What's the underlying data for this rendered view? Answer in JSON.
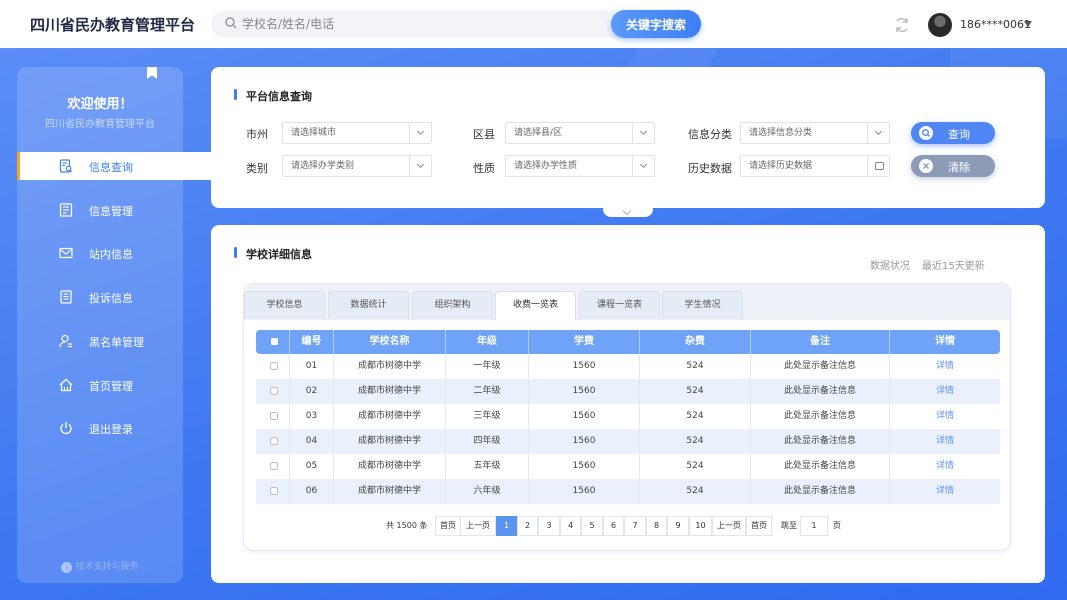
{
  "app": {
    "title": "四川省民办教育管理平台"
  },
  "header": {
    "search_placeholder": "学校名/姓名/电话",
    "search_button": "关键字搜索",
    "user_phone": "186****0061"
  },
  "sidebar": {
    "welcome": "欢迎使用！",
    "subtitle": "四川省民办教育管理平台",
    "items": [
      {
        "label": "信息查询",
        "icon": "search-doc-icon",
        "active": true
      },
      {
        "label": "信息管理",
        "icon": "manage-doc-icon",
        "active": false
      },
      {
        "label": "站内信息",
        "icon": "mail-icon",
        "active": false
      },
      {
        "label": "投诉信息",
        "icon": "complaint-doc-icon",
        "active": false
      },
      {
        "label": "黑名单管理",
        "icon": "user-blacklist-icon",
        "active": false
      },
      {
        "label": "首页管理",
        "icon": "home-icon",
        "active": false
      },
      {
        "label": "退出登录",
        "icon": "power-icon",
        "active": false
      }
    ],
    "footer": "技术支持与服务"
  },
  "query_panel": {
    "title": "平台信息查询",
    "fields": {
      "city": {
        "label": "市州",
        "placeholder": "请选择城市"
      },
      "district": {
        "label": "区县",
        "placeholder": "请选择县/区"
      },
      "info_type": {
        "label": "信息分类",
        "placeholder": "请选择信息分类"
      },
      "category": {
        "label": "类别",
        "placeholder": "请选择办学类别"
      },
      "nature": {
        "label": "性质",
        "placeholder": "请选择办学性质"
      },
      "history": {
        "label": "历史数据",
        "placeholder": "请选择历史数据"
      }
    },
    "query_button": "查询",
    "clear_button": "清除"
  },
  "detail_panel": {
    "title": "学校详细信息",
    "status_label": "数据状况",
    "status_value": "最近15天更新",
    "tabs": [
      "学校信息",
      "数据统计",
      "组织架构",
      "收费一览表",
      "课程一览表",
      "学生情况"
    ],
    "active_tab": 3,
    "columns": [
      "编号",
      "学校名称",
      "年级",
      "学费",
      "杂费",
      "备注",
      "详情"
    ],
    "rows": [
      {
        "id": "01",
        "school": "成都市树德中学",
        "grade": "一年级",
        "tuition": "1560",
        "misc": "524",
        "note": "此处显示备注信息",
        "detail": "详情"
      },
      {
        "id": "02",
        "school": "成都市树德中学",
        "grade": "二年级",
        "tuition": "1560",
        "misc": "524",
        "note": "此处显示备注信息",
        "detail": "详情"
      },
      {
        "id": "03",
        "school": "成都市树德中学",
        "grade": "三年级",
        "tuition": "1560",
        "misc": "524",
        "note": "此处显示备注信息",
        "detail": "详情"
      },
      {
        "id": "04",
        "school": "成都市树德中学",
        "grade": "四年级",
        "tuition": "1560",
        "misc": "524",
        "note": "此处显示备注信息",
        "detail": "详情"
      },
      {
        "id": "05",
        "school": "成都市树德中学",
        "grade": "五年级",
        "tuition": "1560",
        "misc": "524",
        "note": "此处显示备注信息",
        "detail": "详情"
      },
      {
        "id": "06",
        "school": "成都市树德中学",
        "grade": "六年级",
        "tuition": "1560",
        "misc": "524",
        "note": "此处显示备注信息",
        "detail": "详情"
      }
    ],
    "pagination": {
      "total_prefix": "共",
      "total": "1500",
      "total_suffix": "条",
      "first": "首页",
      "prev": "上一页",
      "pages": [
        "1",
        "2",
        "3",
        "4",
        "5",
        "6",
        "7",
        "8",
        "9",
        "10"
      ],
      "current": "1",
      "next": "上一页",
      "last": "首页",
      "jump_label": "跳至",
      "jump_value": "1",
      "page_suffix": "页"
    }
  },
  "colors": {
    "accent": "#3d7ef5",
    "active_marker": "#f5a623",
    "table_header": "#6ea3f8"
  }
}
